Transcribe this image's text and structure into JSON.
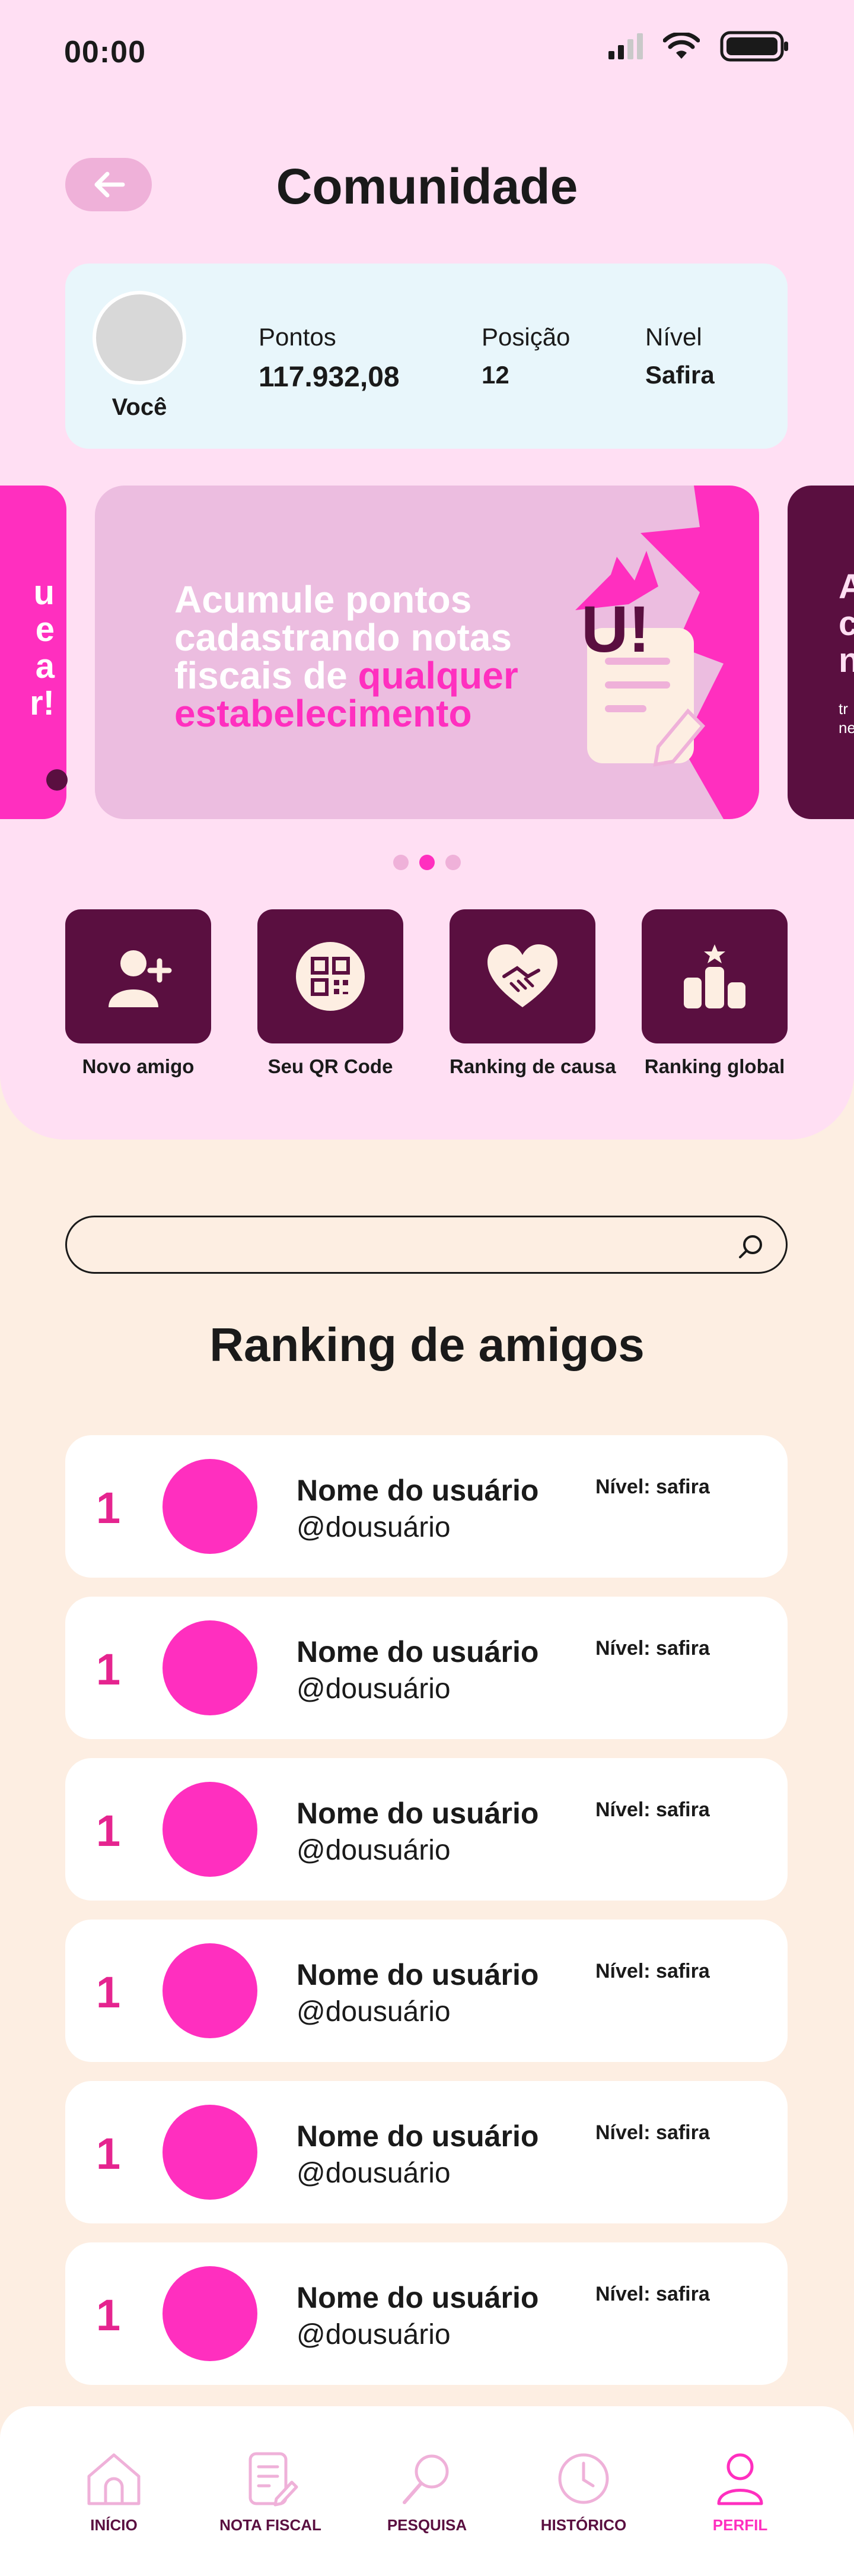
{
  "status_bar": {
    "time": "00:00"
  },
  "header": {
    "title": "Comunidade"
  },
  "user_card": {
    "you_label": "Você",
    "stats": [
      {
        "label": "Pontos",
        "value": "117.932,08"
      },
      {
        "label": "Posição",
        "value": "12"
      },
      {
        "label": "Nível",
        "value": "Safira"
      }
    ]
  },
  "carousel": {
    "left_peek_text": "u\ne\na\nr!",
    "banner_line_plain": "Acumule pontos cadastrando notas fiscais de ",
    "banner_line_highlight": "qualquer estabelecimento",
    "banner_logo": "U!",
    "right_peek_title": "A\nc\nn",
    "right_peek_sub": "tr\nne",
    "dots_count": 3,
    "active_dot": 1
  },
  "actions": [
    {
      "label": "Novo amigo",
      "icon": "add-friend-icon"
    },
    {
      "label": "Seu QR Code",
      "icon": "qr-code-icon"
    },
    {
      "label": "Ranking de causa",
      "icon": "handshake-heart-icon"
    },
    {
      "label": "Ranking global",
      "icon": "podium-icon"
    }
  ],
  "search": {
    "placeholder": "",
    "value": ""
  },
  "ranking": {
    "title": "Ranking de amigos",
    "rows": [
      {
        "position": "1",
        "name": "Nome do usuário",
        "handle": "@dousuário",
        "level": "Nível: safira"
      },
      {
        "position": "1",
        "name": "Nome do usuário",
        "handle": "@dousuário",
        "level": "Nível: safira"
      },
      {
        "position": "1",
        "name": "Nome do usuário",
        "handle": "@dousuário",
        "level": "Nível: safira"
      },
      {
        "position": "1",
        "name": "Nome do usuário",
        "handle": "@dousuário",
        "level": "Nível: safira"
      },
      {
        "position": "1",
        "name": "Nome do usuário",
        "handle": "@dousuário",
        "level": "Nível: safira"
      },
      {
        "position": "1",
        "name": "Nome do usuário",
        "handle": "@dousuário",
        "level": "Nível: safira"
      }
    ]
  },
  "nav": [
    {
      "label": "INÍCIO",
      "icon": "home-icon",
      "active": false
    },
    {
      "label": "NOTA FISCAL",
      "icon": "receipt-icon",
      "active": false
    },
    {
      "label": "PESQUISA",
      "icon": "search-icon",
      "active": false
    },
    {
      "label": "HISTÓRICO",
      "icon": "clock-icon",
      "active": false
    },
    {
      "label": "PERFIL",
      "icon": "profile-icon",
      "active": true
    }
  ],
  "colors": {
    "accent": "#ff2fbf",
    "dark": "#5a0f40",
    "top_bg": "#ffdff3",
    "page_bg": "#fdeee2"
  }
}
